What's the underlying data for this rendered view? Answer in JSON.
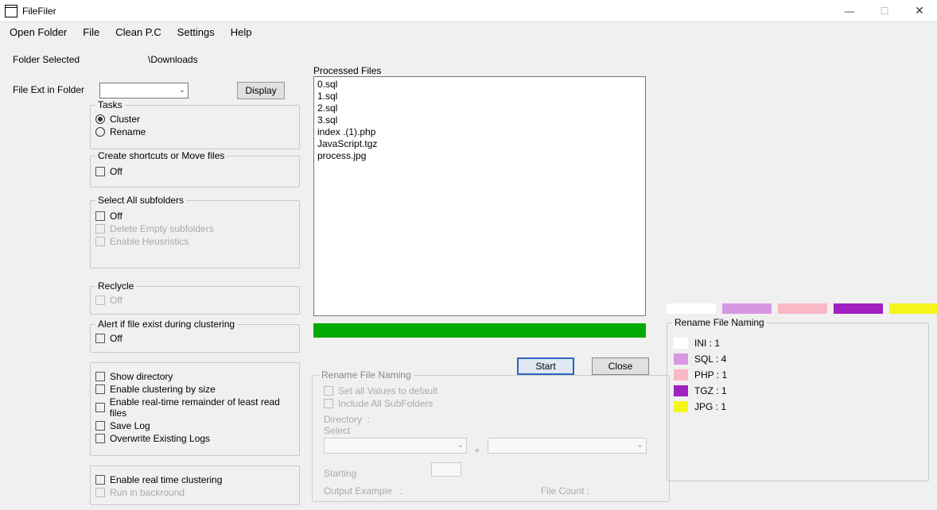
{
  "window": {
    "title": "FileFiler"
  },
  "menu": [
    "Open Folder",
    "File",
    "Clean P.C",
    "Settings",
    "Help"
  ],
  "labels": {
    "folder_selected": "Folder Selected",
    "folder_path": "\\Downloads",
    "file_ext": "File Ext in Folder",
    "display_btn": "Display",
    "processed_files": "Processed Files",
    "start_btn": "Start",
    "close_btn": "Close"
  },
  "tasks": {
    "title": "Tasks",
    "opts": {
      "cluster": "Cluster",
      "rename": "Rename"
    },
    "selected": "cluster"
  },
  "shortcuts": {
    "title": "Create shortcuts or Move files",
    "off": "Off"
  },
  "subfolders": {
    "title": "Select All subfolders",
    "off": "Off",
    "delete_empty": "Delete Empty subfolders",
    "heuristics": "Enable Heusristics"
  },
  "recycle": {
    "title": "Reclycle",
    "off": "Off"
  },
  "alert": {
    "title": "Alert if file exist during clustering",
    "off": "Off"
  },
  "opts1": {
    "show_dir": "Show directory",
    "cluster_size": "Enable clustering by size",
    "realtime_remainder": "Enable real-time remainder of least read files",
    "save_log": "Save Log",
    "overwrite_logs": "Overwrite Existing Logs"
  },
  "opts2": {
    "realtime_cluster": "Enable real time clustering",
    "run_bg": "Run in backround"
  },
  "processed": [
    "0.sql",
    "1.sql",
    "2.sql",
    "3.sql",
    "index .(1).php",
    "JavaScript.tgz",
    "process.jpg"
  ],
  "rename": {
    "title": "Rename File Naming",
    "set_defaults": "Set all Values to default",
    "include_sub": "Include All SubFolders",
    "directory": "Directory",
    "select": "Select",
    "starting": "Starting",
    "output_ex": "Output Example",
    "file_count": "File Count",
    "plus": "+"
  },
  "swatches": [
    {
      "color": "#ffffff"
    },
    {
      "color": "#d897e3"
    },
    {
      "color": "#f8b8c6"
    },
    {
      "color": "#a020c0"
    },
    {
      "color": "#f5f51c"
    }
  ],
  "stats": {
    "title": "Rename File Naming",
    "rows": [
      {
        "label": "INI : 1",
        "color": "#ffffff"
      },
      {
        "label": "SQL : 4",
        "color": "#d897e3"
      },
      {
        "label": "PHP : 1",
        "color": "#f8b8c6"
      },
      {
        "label": "TGZ : 1",
        "color": "#a020c0"
      },
      {
        "label": "JPG : 1",
        "color": "#f5f51c"
      }
    ]
  }
}
